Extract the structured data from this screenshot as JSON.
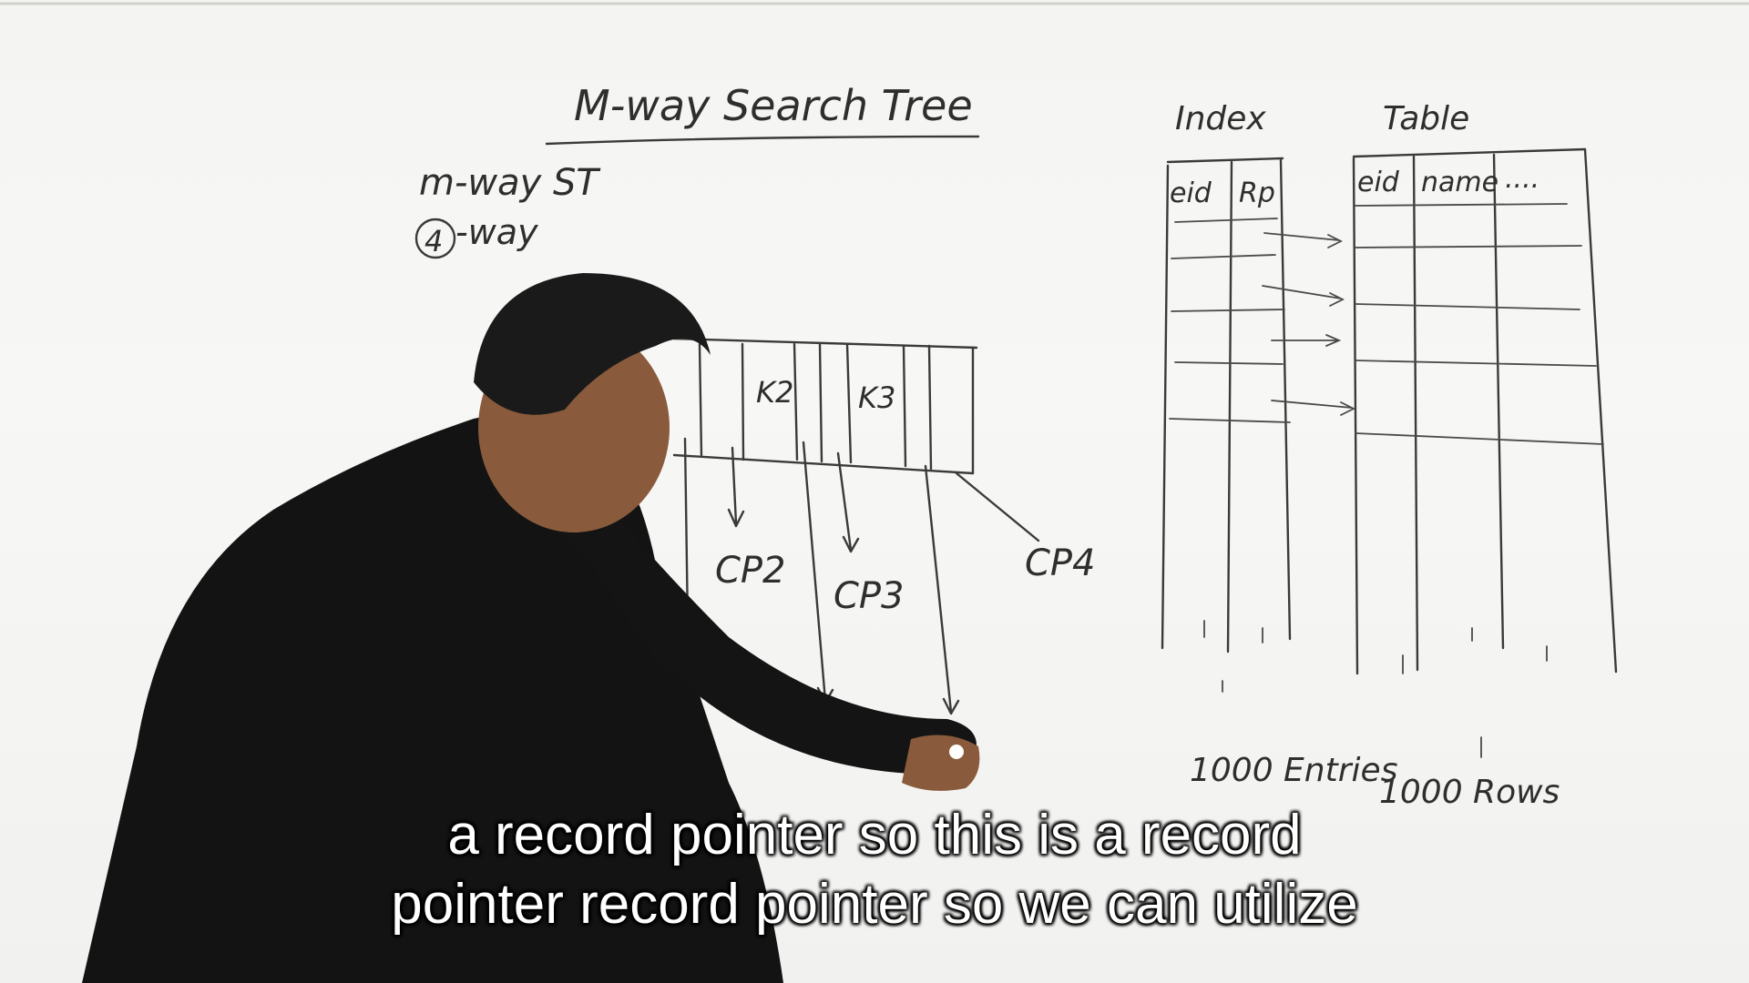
{
  "video": {
    "board": {
      "title": "M-way Search Tree",
      "notes": [
        "m-way ST",
        "-way"
      ],
      "circled_number": "4",
      "keys": [
        "K2",
        "K3"
      ],
      "child_pointers": [
        "CP2",
        "CP3",
        "CP4"
      ],
      "record_pointer": "Rp",
      "index": {
        "heading": "Index",
        "columns": [
          "eid",
          "Rp"
        ],
        "footnote": "1000 Entries"
      },
      "table": {
        "heading": "Table",
        "columns": [
          "eid",
          "name",
          "...."
        ],
        "footnote": "1000 Rows"
      }
    },
    "subtitle": {
      "line1": "a record pointer so this is a record",
      "line2": "pointer record pointer so we can utilize"
    }
  }
}
